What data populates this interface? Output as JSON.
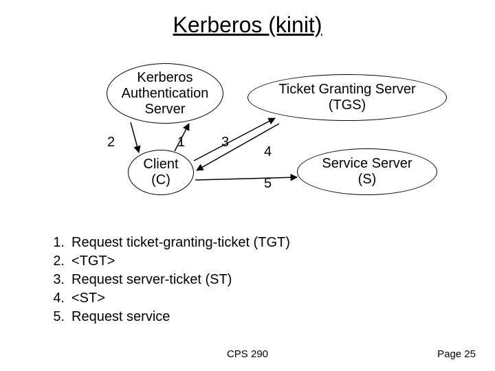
{
  "title": "Kerberos (kinit)",
  "nodes": {
    "kas": "Kerberos\nAuthentication\nServer",
    "tgs": "Ticket Granting Server\n(TGS)",
    "client": "Client\n(C)",
    "ss": "Service Server\n(S)"
  },
  "edge_labels": {
    "e1": "1",
    "e2": "2",
    "e3": "3",
    "e4": "4",
    "e5": "5"
  },
  "steps": [
    {
      "n": "1.",
      "t": "Request ticket-granting-ticket (TGT)"
    },
    {
      "n": "2.",
      "t": "<TGT>"
    },
    {
      "n": "3.",
      "t": "Request server-ticket (ST)"
    },
    {
      "n": "4.",
      "t": "<ST>"
    },
    {
      "n": "5.",
      "t": "Request service"
    }
  ],
  "footer": {
    "course": "CPS 290",
    "page": "Page 25"
  }
}
